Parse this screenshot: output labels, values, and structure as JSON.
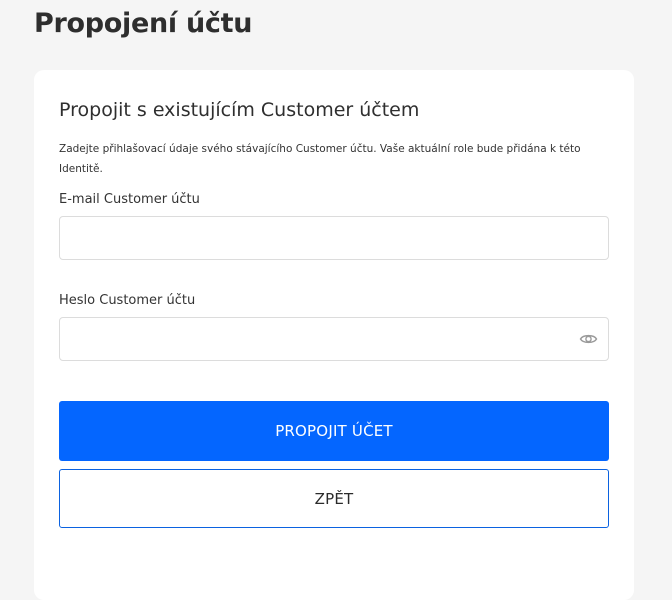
{
  "page": {
    "title": "Propojení účtu"
  },
  "card": {
    "title": "Propojit s existujícím Customer účtem",
    "description": "Zadejte přihlašovací údaje svého stávajícího Customer účtu. Vaše aktuální role bude přidána k této Identitě."
  },
  "form": {
    "email": {
      "label": "E-mail Customer účtu",
      "value": "",
      "placeholder": ""
    },
    "password": {
      "label": "Heslo Customer účtu",
      "value": "",
      "placeholder": "",
      "toggle_icon": "eye-icon"
    }
  },
  "actions": {
    "submit_label": "PROPOJIT ÚČET",
    "back_label": "ZPĚT"
  },
  "colors": {
    "primary": "#0466ff",
    "secondary_border": "#0b62e0",
    "background": "#f5f5f5",
    "card": "#ffffff"
  }
}
